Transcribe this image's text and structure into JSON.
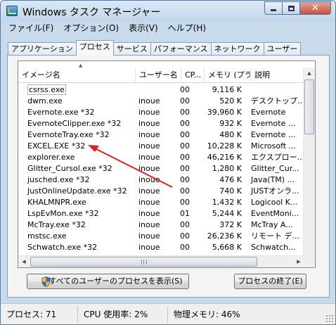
{
  "window": {
    "title": "Windows タスク マネージャー"
  },
  "menu": [
    "ファイル(F)",
    "オプション(O)",
    "表示(V)",
    "ヘルプ(H)"
  ],
  "tabs": [
    {
      "label": "アプリケーション",
      "active": false
    },
    {
      "label": "プロセス",
      "active": true
    },
    {
      "label": "サービス",
      "active": false
    },
    {
      "label": "パフォーマンス",
      "active": false
    },
    {
      "label": "ネットワーク",
      "active": false
    },
    {
      "label": "ユーザー",
      "active": false
    }
  ],
  "columns": [
    "イメージ名",
    "ユーザー名",
    "CP...",
    "メモリ (プラ...",
    "説明"
  ],
  "processes": [
    {
      "name": "csrss.exe",
      "user": "",
      "cpu": "00",
      "mem": "9,116 K",
      "desc": "",
      "selected": true
    },
    {
      "name": "dwm.exe",
      "user": "inoue",
      "cpu": "00",
      "mem": "520 K",
      "desc": "デスクトップ..."
    },
    {
      "name": "Evernote.exe *32",
      "user": "inoue",
      "cpu": "00",
      "mem": "39,960 K",
      "desc": "Evernote"
    },
    {
      "name": "EvernoteClipper.exe *32",
      "user": "inoue",
      "cpu": "00",
      "mem": "932 K",
      "desc": "Evernote ..."
    },
    {
      "name": "EvernoteTray.exe *32",
      "user": "inoue",
      "cpu": "00",
      "mem": "480 K",
      "desc": "Evernote ..."
    },
    {
      "name": "EXCEL.EXE *32",
      "user": "inoue",
      "cpu": "00",
      "mem": "10,228 K",
      "desc": "Microsoft ..."
    },
    {
      "name": "explorer.exe",
      "user": "inoue",
      "cpu": "00",
      "mem": "46,216 K",
      "desc": "エクスプロー..."
    },
    {
      "name": "Glitter_Cursol.exe *32",
      "user": "inoue",
      "cpu": "00",
      "mem": "1,280 K",
      "desc": "Glitter_Cur..."
    },
    {
      "name": "jusched.exe *32",
      "user": "inoue",
      "cpu": "00",
      "mem": "476 K",
      "desc": "Java(TM) ..."
    },
    {
      "name": "JustOnlineUpdate.exe *32",
      "user": "inoue",
      "cpu": "00",
      "mem": "740 K",
      "desc": "JUSTオンラ..."
    },
    {
      "name": "KHALMNPR.exe",
      "user": "inoue",
      "cpu": "00",
      "mem": "1,432 K",
      "desc": "Logicool K..."
    },
    {
      "name": "LspEvMon.exe *32",
      "user": "inoue",
      "cpu": "01",
      "mem": "5,244 K",
      "desc": "EventMoni..."
    },
    {
      "name": "McTray.exe *32",
      "user": "inoue",
      "cpu": "00",
      "mem": "372 K",
      "desc": "McTray A..."
    },
    {
      "name": "mstsc.exe",
      "user": "inoue",
      "cpu": "00",
      "mem": "26,236 K",
      "desc": "リモート デ..."
    },
    {
      "name": "Schwatch.exe *32",
      "user": "inoue",
      "cpu": "00",
      "mem": "5,668 K",
      "desc": "Schwatch..."
    }
  ],
  "buttons": {
    "show_all_users": "すべてのユーザーのプロセスを表示(S)",
    "end_process": "プロセスの終了(E)"
  },
  "status": {
    "processes": "プロセス: 71",
    "cpu": "CPU 使用率: 2%",
    "memory": "物理メモリ: 46%"
  },
  "colors": {
    "annotation_arrow": "#e02020",
    "window_frame": "#c9daea",
    "close_button": "#c7513c"
  }
}
